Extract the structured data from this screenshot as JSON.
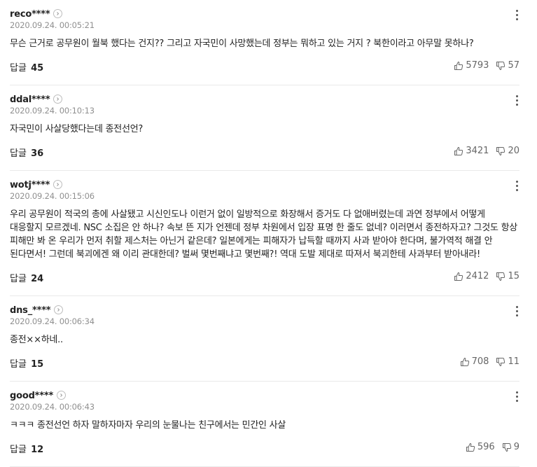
{
  "comments": [
    {
      "user": "reco****",
      "date": "2020.09.24. 00:05:21",
      "text": "무슨 근거로 공무원이 월북 했다는 건지?? 그리고 자국민이 사망했는데 정부는 뭐하고 있는 거지 ? 북한이라고 아무말 못하나?",
      "reply_label": "답글",
      "reply_count": "45",
      "likes": "5793",
      "dislikes": "57"
    },
    {
      "user": "ddal****",
      "date": "2020.09.24. 00:10:13",
      "text": "자국민이 사살당했다는데 종전선언?",
      "reply_label": "답글",
      "reply_count": "36",
      "likes": "3421",
      "dislikes": "20"
    },
    {
      "user": "wotj****",
      "date": "2020.09.24. 00:15:06",
      "text": "우리 공무원이 적국의 총에 사살됐고 시신인도나 이런거 없이 일방적으로 화장해서 증거도 다 없애버렸는데 과연 정부에서 어떻게 대응할지 모르겠네. NSC 소집은 안 하나? 속보 뜬 지가 언젠데 정부 차원에서 입장 표명 한 줄도 없네? 이러면서 종전하자고? 그것도 항상 피해만 봐 온 우리가 먼저 취할 제스처는 아닌거 같은데? 일본에게는 피해자가 납득할 때까지 사과 받아야 한다며, 불가역적 해결 안 된다면서! 그런데 북괴에겐 왜 이리 관대한데? 벌써 몇번째냐고 몇번째?! 역대 도발 제대로 따져서 북괴한테 사과부터 받아내라!",
      "reply_label": "답글",
      "reply_count": "24",
      "likes": "2412",
      "dislikes": "15"
    },
    {
      "user": "dns_****",
      "date": "2020.09.24. 00:06:34",
      "text": "종전××하네..",
      "reply_label": "답글",
      "reply_count": "15",
      "likes": "708",
      "dislikes": "11"
    },
    {
      "user": "good****",
      "date": "2020.09.24. 00:06:43",
      "text": "ㅋㅋㅋ 종전선언 하자 말하자마자 우리의 눈물나는 친구에서는 민간인 사살",
      "reply_label": "답글",
      "reply_count": "12",
      "likes": "596",
      "dislikes": "9"
    }
  ]
}
